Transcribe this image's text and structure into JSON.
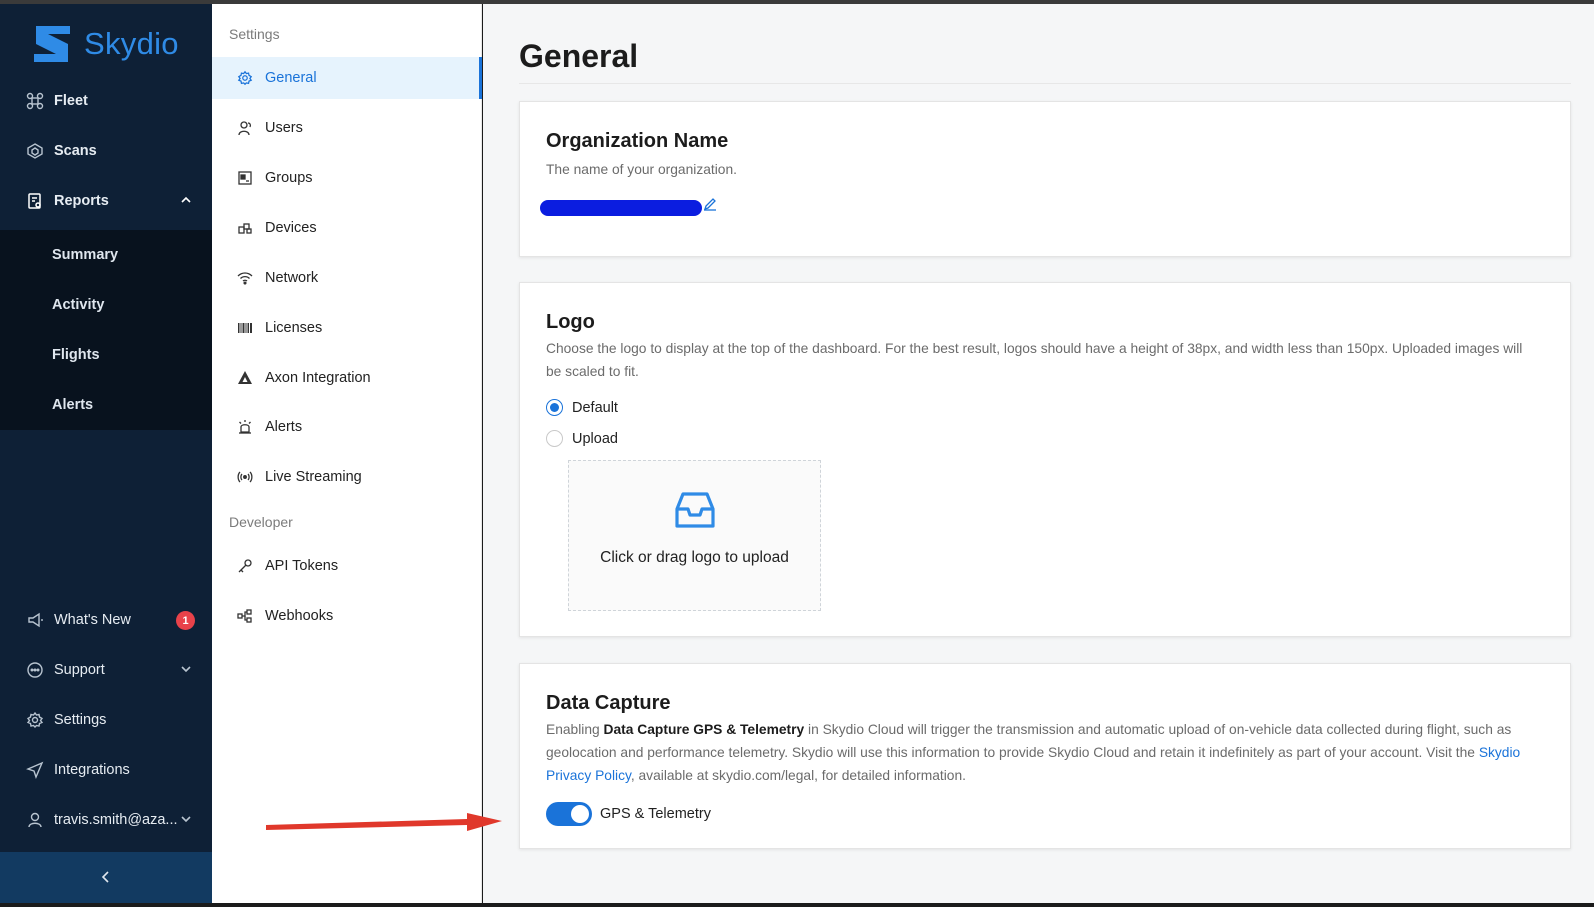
{
  "brand": {
    "name": "Skydio",
    "color": "#2f8be6"
  },
  "nav": {
    "items": [
      {
        "label": "Fleet",
        "icon": "fleet-icon"
      },
      {
        "label": "Scans",
        "icon": "scans-icon"
      },
      {
        "label": "Reports",
        "icon": "reports-icon"
      }
    ],
    "reports_sub": [
      "Summary",
      "Activity",
      "Flights",
      "Alerts"
    ],
    "bottom": [
      {
        "label": "What's New",
        "icon": "megaphone-icon",
        "badge": "1"
      },
      {
        "label": "Support",
        "icon": "chat-icon"
      },
      {
        "label": "Settings",
        "icon": "gear-icon"
      },
      {
        "label": "Integrations",
        "icon": "send-icon"
      },
      {
        "label": "travis.smith@aza...",
        "icon": "user-icon"
      }
    ]
  },
  "menu": {
    "settings_heading": "Settings",
    "settings_items": [
      {
        "label": "General",
        "icon": "gear-icon"
      },
      {
        "label": "Users",
        "icon": "users-icon"
      },
      {
        "label": "Groups",
        "icon": "groups-icon"
      },
      {
        "label": "Devices",
        "icon": "devices-icon"
      },
      {
        "label": "Network",
        "icon": "wifi-icon"
      },
      {
        "label": "Licenses",
        "icon": "barcode-icon"
      },
      {
        "label": "Axon Integration",
        "icon": "axon-icon"
      },
      {
        "label": "Alerts",
        "icon": "alarm-icon"
      },
      {
        "label": "Live Streaming",
        "icon": "broadcast-icon"
      }
    ],
    "developer_heading": "Developer",
    "developer_items": [
      {
        "label": "API Tokens",
        "icon": "key-icon"
      },
      {
        "label": "Webhooks",
        "icon": "webhook-icon"
      }
    ]
  },
  "main": {
    "title": "General",
    "org": {
      "heading": "Organization Name",
      "description": "The name of your organization."
    },
    "logo": {
      "heading": "Logo",
      "description": "Choose the logo to display at the top of the dashboard. For the best result, logos should have a height of 38px, and width less than 150px. Uploaded images will be scaled to fit.",
      "option_default": "Default",
      "option_upload": "Upload",
      "dropzone_text": "Click or drag logo to upload"
    },
    "data_capture": {
      "heading": "Data Capture",
      "desc_pre": "Enabling ",
      "desc_bold": "Data Capture GPS & Telemetry",
      "desc_mid": " in Skydio Cloud will trigger the transmission and automatic upload of on-vehicle data collected during flight, such as geolocation and performance telemetry. Skydio will use this information to provide Skydio Cloud and retain it indefinitely as part of your account. Visit the ",
      "desc_link": "Skydio Privacy Policy",
      "desc_post": ", available at skydio.com/legal, for detailed information.",
      "toggle_label": "GPS & Telemetry"
    }
  },
  "colors": {
    "accent": "#1a73d9",
    "nav_bg": "#0e2036",
    "badge": "#e8424a",
    "annotation_arrow": "#e0382b"
  }
}
